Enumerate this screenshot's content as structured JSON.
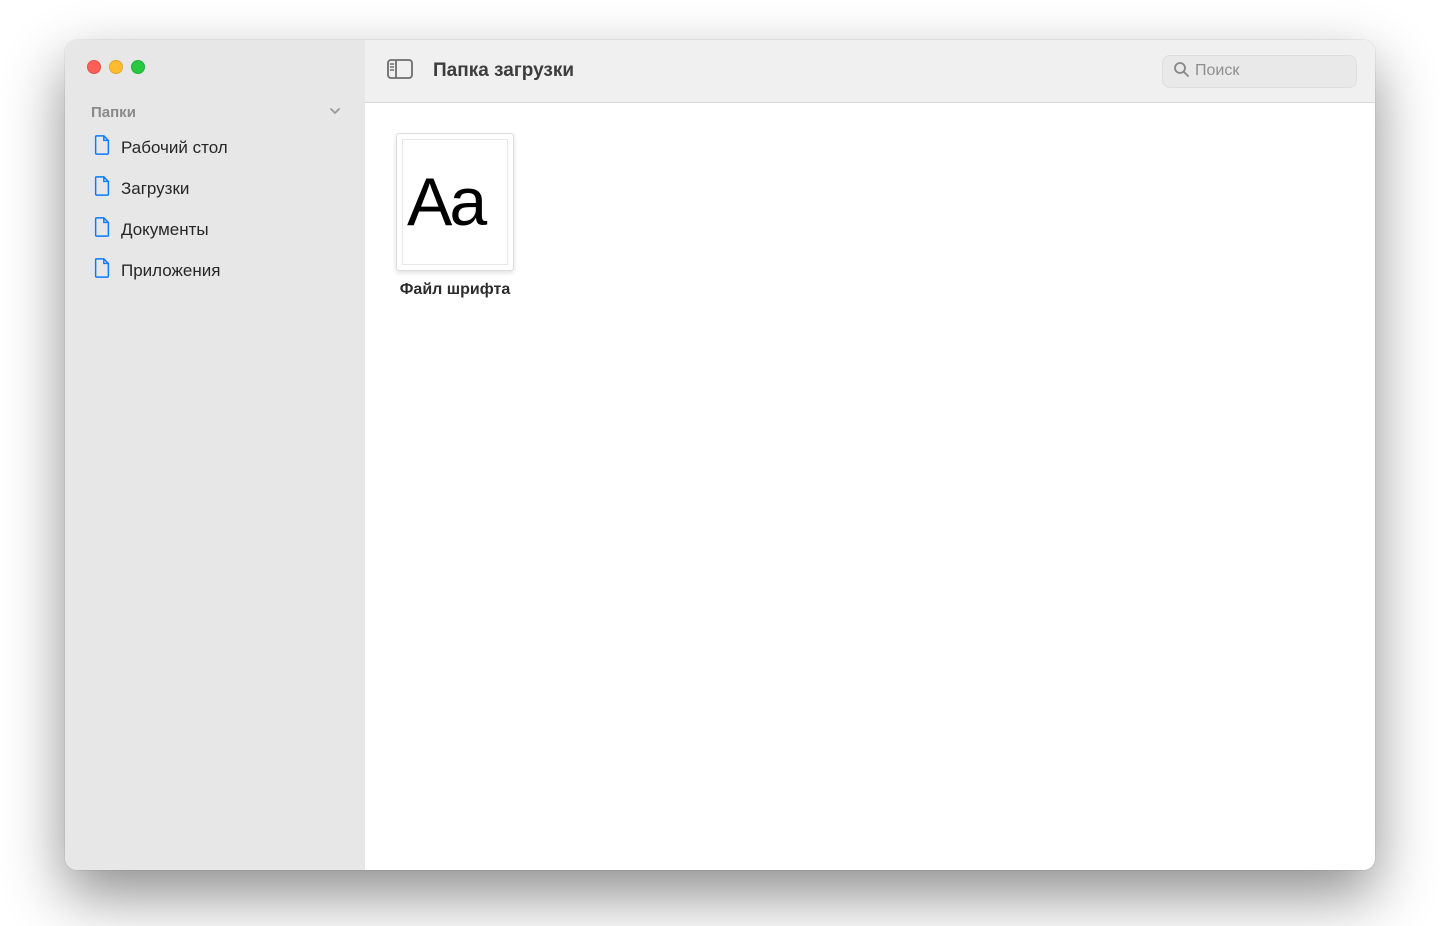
{
  "sidebar": {
    "section_title": "Папки",
    "items": [
      {
        "label": "Рабочий стол"
      },
      {
        "label": "Загрузки"
      },
      {
        "label": "Документы"
      },
      {
        "label": "Приложения"
      }
    ]
  },
  "toolbar": {
    "title": "Папка загрузки",
    "search_placeholder": "Поиск"
  },
  "files": [
    {
      "label": "Файл шрифта",
      "glyph": "Aa",
      "type": "font"
    }
  ]
}
